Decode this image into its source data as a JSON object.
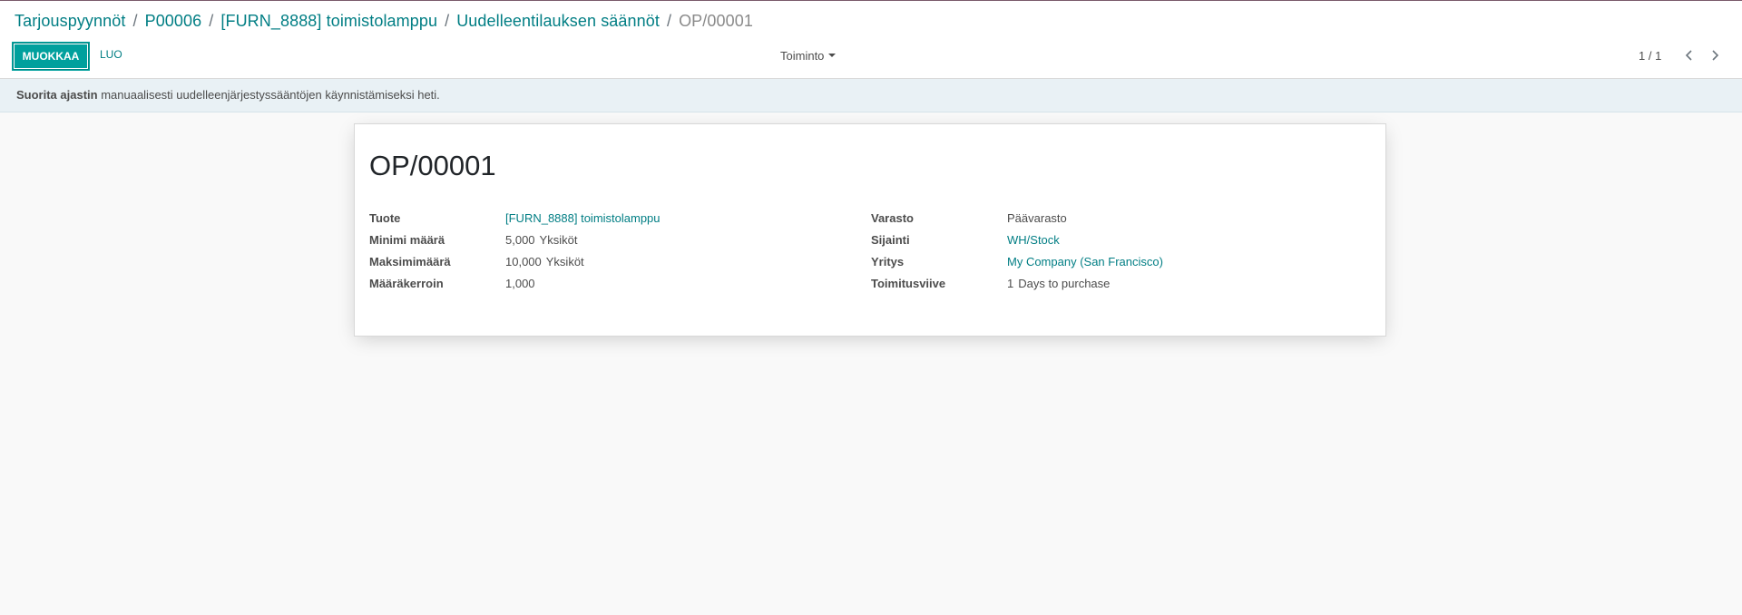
{
  "breadcrumb": [
    {
      "label": "Tarjouspyynnöt"
    },
    {
      "label": "P00006"
    },
    {
      "label": "[FURN_8888] toimistolamppu"
    },
    {
      "label": "Uudelleentilauksen säännöt"
    },
    {
      "label": "OP/00001"
    }
  ],
  "breadcrumb_separator": "/",
  "toolbar": {
    "edit_label": "MUOKKAA",
    "create_label": "LUO",
    "action_label": "Toiminto"
  },
  "pager": {
    "value": "1 / 1",
    "prev_icon": "chevron-left-icon",
    "next_icon": "chevron-right-icon"
  },
  "alert": {
    "bold": "Suorita ajastin",
    "text": " manuaalisesti uudelleenjärjestyssääntöjen käynnistämiseksi heti."
  },
  "record": {
    "title": "OP/00001",
    "left_fields": {
      "product": {
        "label": "Tuote",
        "value": "[FURN_8888] toimistolamppu"
      },
      "min_qty": {
        "label": "Minimi määrä",
        "value": "5,000",
        "uom": "Yksiköt"
      },
      "max_qty": {
        "label": "Maksimimäärä",
        "value": "10,000",
        "uom": "Yksiköt"
      },
      "multiple": {
        "label": "Määräkerroin",
        "value": "1,000"
      }
    },
    "right_fields": {
      "warehouse": {
        "label": "Varasto",
        "value": "Päävarasto"
      },
      "location": {
        "label": "Sijainti",
        "value": "WH/Stock"
      },
      "company": {
        "label": "Yritys",
        "value": "My Company (San Francisco)"
      },
      "lead_time": {
        "label": "Toimitusviive",
        "value": "1",
        "unit": "Days to purchase"
      }
    }
  },
  "colors": {
    "primary": "#00a09d",
    "link": "#017e84",
    "alert_bg": "#e9f1f5"
  }
}
